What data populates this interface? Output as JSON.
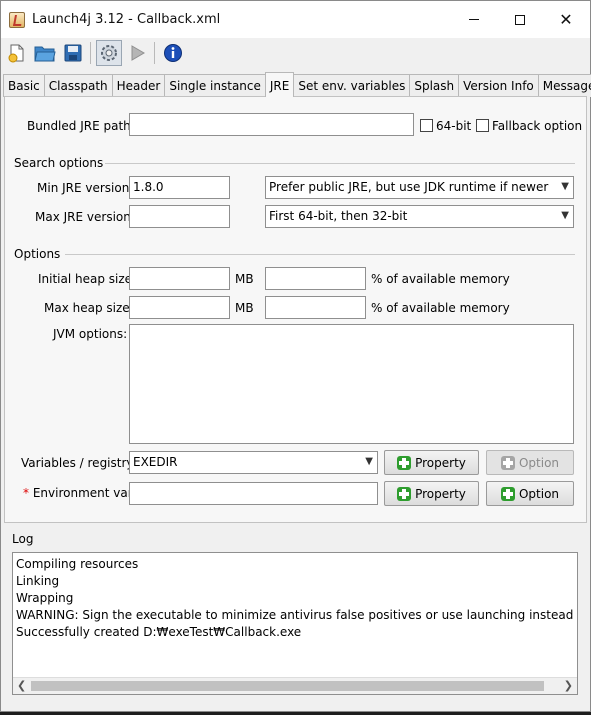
{
  "window": {
    "title": "Launch4j 3.12 - Callback.xml"
  },
  "toolbar": {
    "icons": [
      "new-file-icon",
      "open-folder-icon",
      "save-icon",
      "build-wrapper-icon",
      "run-icon",
      "about-icon"
    ]
  },
  "tabs": [
    {
      "label": "Basic"
    },
    {
      "label": "Classpath"
    },
    {
      "label": "Header"
    },
    {
      "label": "Single instance"
    },
    {
      "label": "JRE",
      "active": true
    },
    {
      "label": "Set env. variables"
    },
    {
      "label": "Splash"
    },
    {
      "label": "Version Info"
    },
    {
      "label": "Messages"
    }
  ],
  "jre": {
    "bundled_path_label": "Bundled JRE path:",
    "bundled_path_value": "",
    "bit64_label": "64-bit",
    "fallback_label": "Fallback option",
    "search_options_title": "Search options",
    "min_version_label": "Min JRE version:",
    "min_version_value": "1.8.0",
    "max_version_label": "Max JRE version:",
    "max_version_value": "",
    "jdk_preference": "Prefer public JRE, but use JDK runtime if newer",
    "runtime_bits": "First 64-bit, then 32-bit",
    "options_title": "Options",
    "initial_heap_label": "Initial heap size:",
    "initial_heap_value": "",
    "max_heap_label": "Max heap size:",
    "max_heap_value": "",
    "mb_unit": "MB",
    "percent_label": "% of available memory",
    "jvm_options_label": "JVM options:",
    "variables_label": "Variables / registry:",
    "variables_value": "EXEDIR",
    "env_var_label": "Environment var:",
    "required_marker": "*",
    "property_label": "Property",
    "option_label": "Option"
  },
  "log": {
    "title": "Log",
    "lines": [
      "Compiling resources",
      "Linking",
      "Wrapping",
      "WARNING: Sign the executable to minimize antivirus false positives or use launching instead of wrappin",
      "Successfully created D:₩exeTest₩Callback.exe"
    ]
  }
}
